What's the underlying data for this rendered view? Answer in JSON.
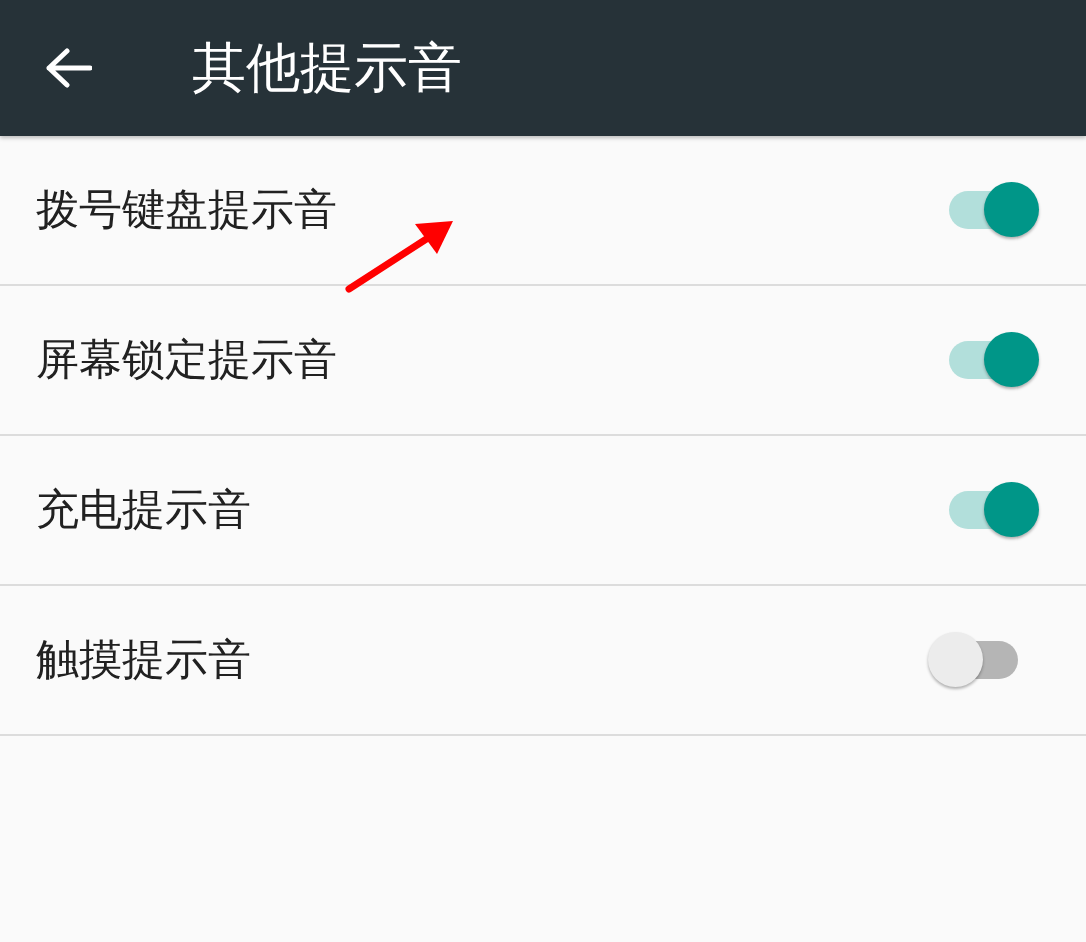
{
  "app_bar": {
    "title": "其他提示音"
  },
  "settings": [
    {
      "label": "拨号键盘提示音",
      "on": true
    },
    {
      "label": "屏幕锁定提示音",
      "on": true
    },
    {
      "label": "充电提示音",
      "on": true
    },
    {
      "label": "触摸提示音",
      "on": false
    }
  ]
}
